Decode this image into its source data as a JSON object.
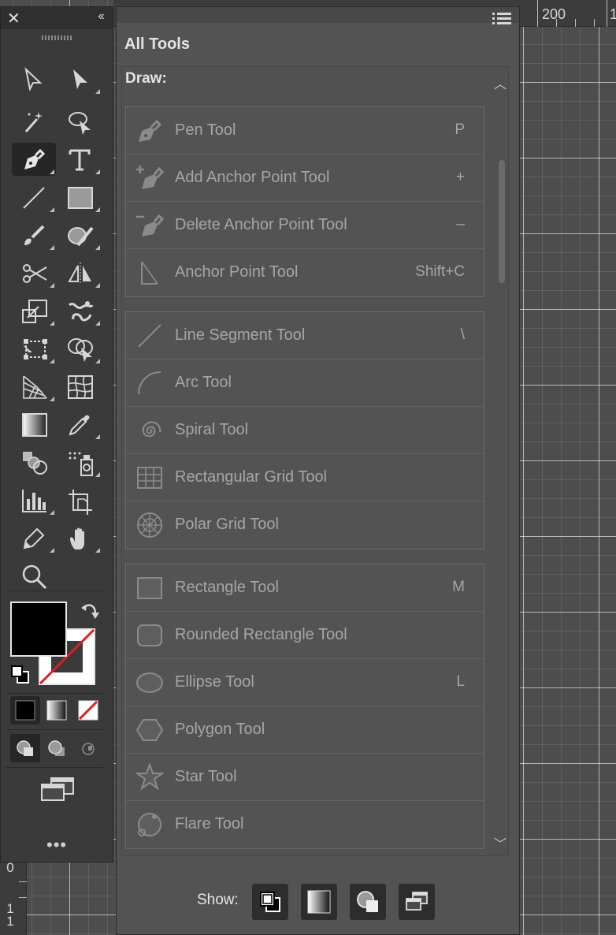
{
  "ruler": {
    "top_labels": [
      "200",
      "1"
    ],
    "left_labels": [
      "0",
      "1",
      "1"
    ]
  },
  "toolbar": {
    "close_glyph": "✕",
    "collapse_glyph": "‹‹",
    "more_glyph": "•••",
    "tool_icons": [
      "selection-tool-icon",
      "direct-selection-tool-icon",
      "magic-wand-tool-icon",
      "lasso-tool-icon",
      "pen-tool-icon",
      "type-tool-icon",
      "line-segment-tool-icon",
      "rectangle-tool-icon",
      "paintbrush-tool-icon",
      "shaper-tool-icon",
      "scissors-tool-icon",
      "reflect-tool-icon",
      "scale-tool-icon",
      "warp-tool-icon",
      "free-transform-tool-icon",
      "shape-builder-tool-icon",
      "perspective-grid-tool-icon",
      "mesh-tool-icon",
      "gradient-tool-icon",
      "eyedropper-tool-icon",
      "blend-tool-icon",
      "symbol-sprayer-tool-icon",
      "column-graph-tool-icon",
      "artboard-tool-icon",
      "pencil-tool-icon",
      "hand-tool-icon",
      "zoom-tool-icon"
    ],
    "active_tool": "pen-tool-icon",
    "fill_color": "#000000",
    "stroke_color": "none"
  },
  "panel": {
    "title": "All Tools",
    "section": "Draw:",
    "groups": [
      [
        {
          "name": "Pen Tool",
          "key": "P",
          "icon": "pen-icon"
        },
        {
          "name": "Add Anchor Point Tool",
          "key": "+",
          "icon": "add-anchor-point-icon"
        },
        {
          "name": "Delete Anchor Point Tool",
          "key": "–",
          "icon": "delete-anchor-point-icon"
        },
        {
          "name": "Anchor Point Tool",
          "key": "Shift+C",
          "icon": "anchor-point-icon"
        }
      ],
      [
        {
          "name": "Line Segment Tool",
          "key": "\\",
          "icon": "line-segment-icon"
        },
        {
          "name": "Arc Tool",
          "key": "",
          "icon": "arc-icon"
        },
        {
          "name": "Spiral Tool",
          "key": "",
          "icon": "spiral-icon"
        },
        {
          "name": "Rectangular Grid Tool",
          "key": "",
          "icon": "rectangular-grid-icon"
        },
        {
          "name": "Polar Grid Tool",
          "key": "",
          "icon": "polar-grid-icon"
        }
      ],
      [
        {
          "name": "Rectangle Tool",
          "key": "M",
          "icon": "rectangle-icon"
        },
        {
          "name": "Rounded Rectangle Tool",
          "key": "",
          "icon": "rounded-rectangle-icon"
        },
        {
          "name": "Ellipse Tool",
          "key": "L",
          "icon": "ellipse-icon"
        },
        {
          "name": "Polygon Tool",
          "key": "",
          "icon": "polygon-icon"
        },
        {
          "name": "Star Tool",
          "key": "",
          "icon": "star-icon"
        },
        {
          "name": "Flare Tool",
          "key": "",
          "icon": "flare-icon"
        }
      ]
    ],
    "show_label": "Show:",
    "show_buttons": [
      "fill-stroke-icon",
      "gradient-swatch-icon",
      "draw-modes-icon",
      "change-screen-mode-icon"
    ]
  }
}
